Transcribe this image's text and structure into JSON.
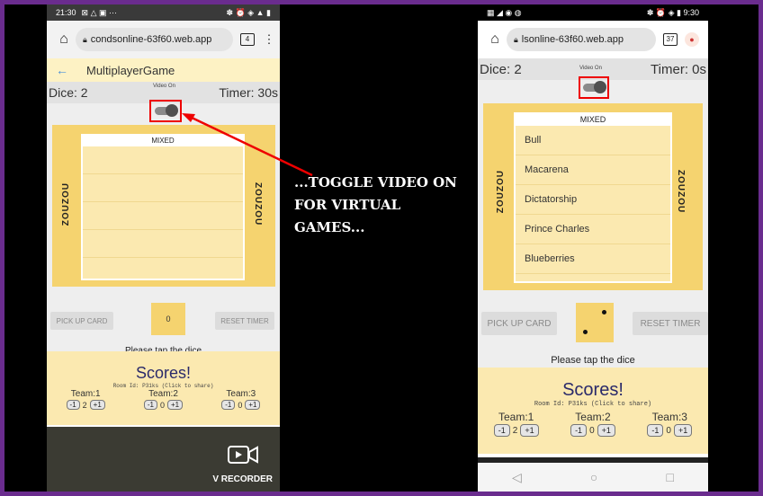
{
  "annotation": {
    "text": "...TOGGLE VIDEO ON FOR VIRTUAL GAMES..."
  },
  "left": {
    "status_time": "21:30",
    "status_icons": "⊠ △ ▣ ···",
    "status_right": "✽ ⏰ ◈ ▲ ▮",
    "url": "condsonline-63f60.web.app",
    "tab_count": "4",
    "app_title": "MultiplayerGame",
    "dice_label": "Dice: 2",
    "video_label": "Video On",
    "timer_label": "Timer: 30s",
    "team_name": "ZOUZOU",
    "card_title": "MIXED",
    "pickup_label": "PICK UP CARD",
    "die_value": "0",
    "reset_label": "RESET TIMER",
    "tap_text": "Please tap the dice",
    "scores_title": "Scores!",
    "room_text": "Room Id: P31ks (Click to share)",
    "teams": [
      {
        "name": "Team:1",
        "minus": "-1",
        "value": "2",
        "plus": "+1"
      },
      {
        "name": "Team:2",
        "minus": "-1",
        "value": "0",
        "plus": "+1"
      },
      {
        "name": "Team:3",
        "minus": "-1",
        "value": "0",
        "plus": "+1"
      }
    ],
    "recorder_label": "V RECORDER"
  },
  "right": {
    "status_left": "▦ ◢ ◉ ◍",
    "status_right": "✽ ⏰ ◈ ▮ 9:30",
    "url": "lsonline-63f60.web.app",
    "tab_count": "37",
    "dice_label": "Dice: 2",
    "video_label": "Video On",
    "timer_label": "Timer: 0s",
    "team_name": "ZOUZOU",
    "card_title": "MIXED",
    "card_items": [
      "Bull",
      "Macarena",
      "Dictatorship",
      "Prince Charles",
      "Blueberries"
    ],
    "pickup_label": "PICK UP CARD",
    "reset_label": "RESET TIMER",
    "tap_text": "Please tap the dice",
    "scores_title": "Scores!",
    "room_text": "Room Id: P31ks (Click to share)",
    "teams": [
      {
        "name": "Team:1",
        "minus": "-1",
        "value": "2",
        "plus": "+1"
      },
      {
        "name": "Team:2",
        "minus": "-1",
        "value": "0",
        "plus": "+1"
      },
      {
        "name": "Team:3",
        "minus": "-1",
        "value": "0",
        "plus": "+1"
      }
    ],
    "nav_icons": [
      "◁",
      "○",
      "□"
    ]
  },
  "colors": {
    "highlight": "#ee0000",
    "board": "#f5d36f",
    "frame": "#6a2c8e"
  }
}
